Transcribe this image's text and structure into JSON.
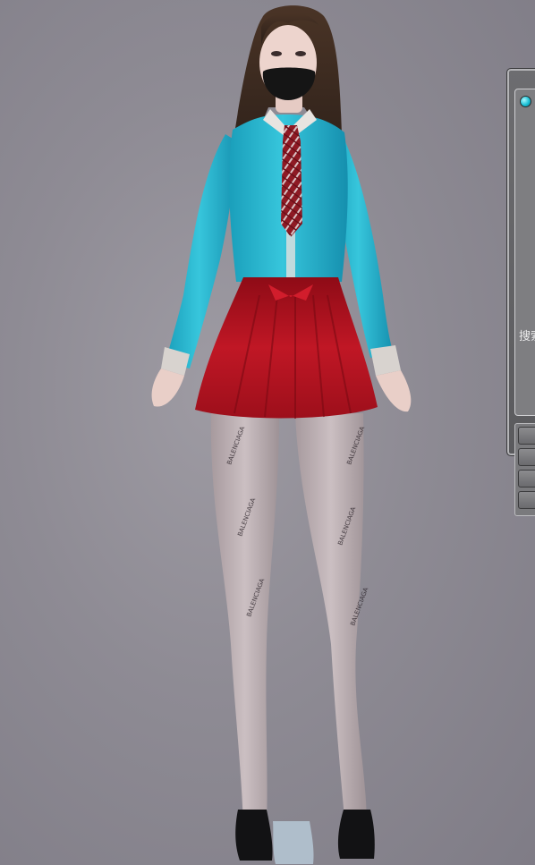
{
  "scene": {
    "background_color": "#8e8b94",
    "character": {
      "shirt_color": "#22b2cc",
      "skirt_color": "#b0121e",
      "tie_color": "#8e1a24",
      "hair_color": "#3b2a20",
      "mask_color": "#151515",
      "stocking_text": "BALENCIAGA"
    }
  },
  "panel": {
    "status_icon": "status-indicator-icon",
    "search_label": "搜索",
    "list_buttons": [
      "",
      "",
      "",
      ""
    ]
  }
}
